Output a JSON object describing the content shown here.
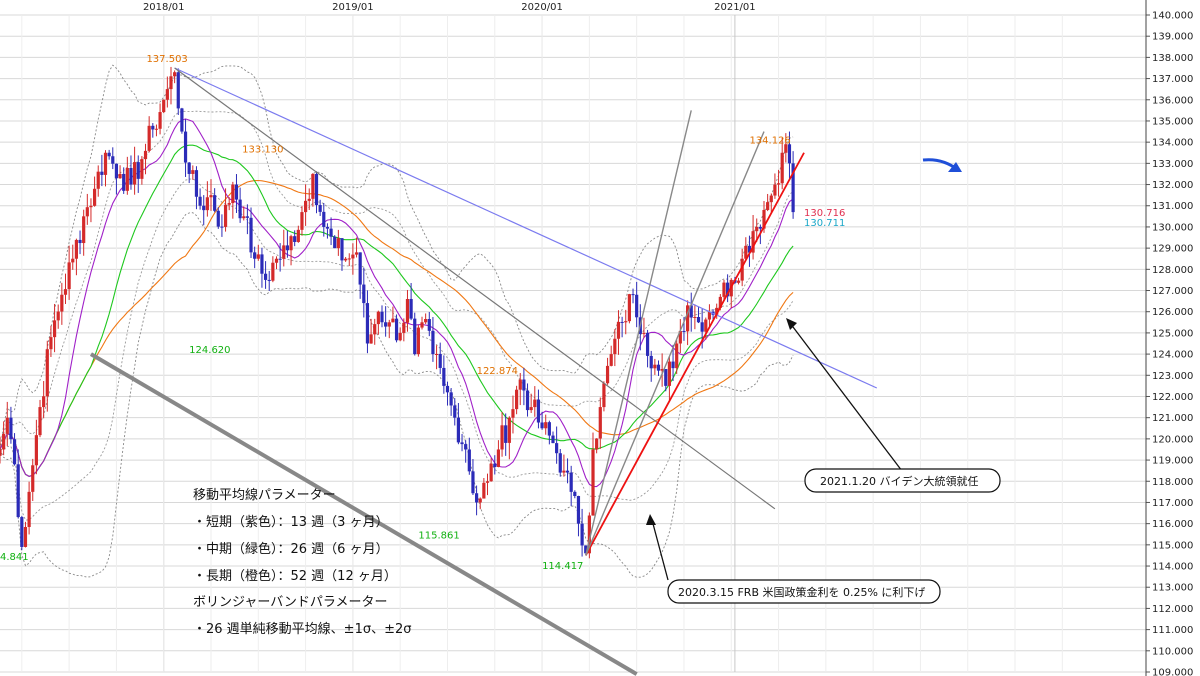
{
  "chart_data": {
    "type": "candlestick",
    "title": "",
    "xlabel": "",
    "ylabel": "",
    "x_ticks": [
      "2018/01",
      "2019/01",
      "2020/01",
      "2021/01"
    ],
    "x_tick_weeks": [
      0,
      52,
      104,
      157
    ],
    "x_range_weeks": [
      -45,
      270
    ],
    "y_range": [
      109.0,
      140.0
    ],
    "y_ticks": [
      "109.000",
      "110.000",
      "111.000",
      "112.000",
      "113.000",
      "114.000",
      "115.000",
      "116.000",
      "117.000",
      "118.000",
      "119.000",
      "120.000",
      "121.000",
      "122.000",
      "123.000",
      "124.000",
      "125.000",
      "126.000",
      "127.000",
      "128.000",
      "129.000",
      "130.000",
      "131.000",
      "132.000",
      "133.000",
      "134.000",
      "135.000",
      "136.000",
      "137.000",
      "138.000",
      "139.000",
      "140.000"
    ],
    "grid": true,
    "series": [
      {
        "name": "短期（紫色）：13週",
        "color": "#a020c8"
      },
      {
        "name": "中期（緑色）：26週",
        "color": "#1ec81e"
      },
      {
        "name": "長期（橙色）：52週",
        "color": "#f07814"
      },
      {
        "name": "±1σ / ±2σ",
        "color": "#666666"
      }
    ],
    "price_anchors": [
      [
        -45,
        119.5
      ],
      [
        -43,
        121.0
      ],
      [
        -41,
        118.8
      ],
      [
        -39,
        114.9
      ],
      [
        -37,
        117.5
      ],
      [
        -34,
        121.5
      ],
      [
        -31,
        124.8
      ],
      [
        -28,
        126.8
      ],
      [
        -25,
        128.5
      ],
      [
        -22,
        130.5
      ],
      [
        -19,
        131.8
      ],
      [
        -16,
        133.5
      ],
      [
        -12,
        132.5
      ],
      [
        -9,
        132.0
      ],
      [
        -6,
        133.2
      ],
      [
        -3,
        134.6
      ],
      [
        0,
        136.0
      ],
      [
        3,
        137.3
      ],
      [
        5,
        134.5
      ],
      [
        7,
        132.5
      ],
      [
        10,
        131.0
      ],
      [
        13,
        131.5
      ],
      [
        16,
        130.0
      ],
      [
        19,
        132.0
      ],
      [
        22,
        130.5
      ],
      [
        25,
        128.5
      ],
      [
        28,
        127.5
      ],
      [
        31,
        128.5
      ],
      [
        34,
        128.9
      ],
      [
        38,
        130.7
      ],
      [
        41,
        132.5
      ],
      [
        44,
        130.0
      ],
      [
        47,
        129.0
      ],
      [
        50,
        128.5
      ],
      [
        53,
        128.8
      ],
      [
        56,
        124.5
      ],
      [
        59,
        126.0
      ],
      [
        62,
        125.5
      ],
      [
        65,
        125.0
      ],
      [
        67,
        126.6
      ],
      [
        69,
        124.0
      ],
      [
        71,
        125.5
      ],
      [
        74,
        124.0
      ],
      [
        77,
        122.5
      ],
      [
        80,
        121.0
      ],
      [
        83,
        119.5
      ],
      [
        86,
        117.0
      ],
      [
        89,
        118.0
      ],
      [
        92,
        119.5
      ],
      [
        95,
        121.0
      ],
      [
        98,
        122.8
      ],
      [
        101,
        121.5
      ],
      [
        104,
        120.5
      ],
      [
        107,
        119.8
      ],
      [
        110,
        118.5
      ],
      [
        112,
        117.5
      ],
      [
        114,
        116.0
      ],
      [
        116,
        114.6
      ],
      [
        118,
        119.5
      ],
      [
        120,
        121.5
      ],
      [
        123,
        124.0
      ],
      [
        126,
        125.5
      ],
      [
        129,
        126.8
      ],
      [
        132,
        125.0
      ],
      [
        135,
        123.5
      ],
      [
        138,
        122.5
      ],
      [
        141,
        124.5
      ],
      [
        144,
        126.3
      ],
      [
        147,
        125.5
      ],
      [
        150,
        126.0
      ],
      [
        153,
        126.7
      ],
      [
        156,
        127.5
      ],
      [
        159,
        128.5
      ],
      [
        162,
        129.8
      ],
      [
        165,
        130.8
      ],
      [
        168,
        132.0
      ],
      [
        170,
        133.5
      ],
      [
        171,
        133.9
      ],
      [
        172,
        133.0
      ],
      [
        173,
        130.7
      ]
    ],
    "trend_lines": [
      {
        "from": [
          3,
          137.5
        ],
        "to": [
          196,
          122.4
        ],
        "color": "#7b7bef",
        "width": 1.2
      },
      {
        "from": [
          3,
          137.5
        ],
        "to": [
          168,
          116.7
        ],
        "color": "#777777",
        "width": 1.2
      },
      {
        "from": [
          -20,
          124.0
        ],
        "to": [
          130,
          108.9
        ],
        "color": "#888888",
        "width": 4
      },
      {
        "from": [
          116,
          114.5
        ],
        "to": [
          176,
          133.5
        ],
        "color": "#ee1111",
        "width": 1.8
      },
      {
        "from": [
          116,
          114.5
        ],
        "to": [
          145,
          135.5
        ],
        "color": "#888888",
        "width": 1.4
      },
      {
        "from": [
          116,
          114.5
        ],
        "to": [
          165,
          134.5
        ],
        "color": "#888888",
        "width": 1.4
      }
    ],
    "price_labels": [
      {
        "text": "137.503",
        "w": -2,
        "y": 137.503,
        "color": "#e07000",
        "dx": -10,
        "dy": -6
      },
      {
        "text": "133.130",
        "w": 21,
        "y": 133.13,
        "color": "#e07000",
        "dx": 2,
        "dy": -8
      },
      {
        "text": "124.620",
        "w": 7,
        "y": 124.62,
        "color": "#10b010",
        "dx": 0,
        "dy": 12
      },
      {
        "text": "122.874",
        "w": 86,
        "y": 122.874,
        "color": "#e07000",
        "dx": 0,
        "dy": -4
      },
      {
        "text": "115.861",
        "w": 70,
        "y": 115.861,
        "color": "#10b010",
        "dx": 0,
        "dy": 12
      },
      {
        "text": "114.417",
        "w": 104,
        "y": 114.417,
        "color": "#10b010",
        "dx": 0,
        "dy": 12
      },
      {
        "text": "134.126",
        "w": 161,
        "y": 134.126,
        "color": "#e07000",
        "dx": 0,
        "dy": 4
      },
      {
        "text": "130.716",
        "w": 176,
        "y": 130.716,
        "color": "#e03050",
        "dx": 0,
        "dy": 4
      },
      {
        "text": "130.711",
        "w": 176,
        "y": 130.711,
        "color": "#1aa7c8",
        "dx": 0,
        "dy": 14
      },
      {
        "text": "4.841",
        "w": -45,
        "y": 114.841,
        "color": "#10b010",
        "dx": 0,
        "dy": 12
      }
    ],
    "annotations": {
      "title": "移動平均線パラメーター",
      "short": "・短期（紫色）：13 週（3 ヶ月）",
      "mid": "・中期（緑色）：26 週（6 ヶ月）",
      "long": "・長期（橙色）：52 週（12 ヶ月）",
      "bb_title": "ボリンジャーバンドパラメーター",
      "bb": "・26 週単純移動平均線、±1σ、±2σ",
      "callout_biden": "2021.1.20 バイデン大統領就任",
      "callout_frb": "2020.3.15 FRB 米国政策金利を 0.25% に利下げ"
    },
    "colors": {
      "up": "#d42a2a",
      "down": "#2b2bb8",
      "grid": "#d8d8d8",
      "blue_arrow": "#1f4fd8"
    }
  }
}
